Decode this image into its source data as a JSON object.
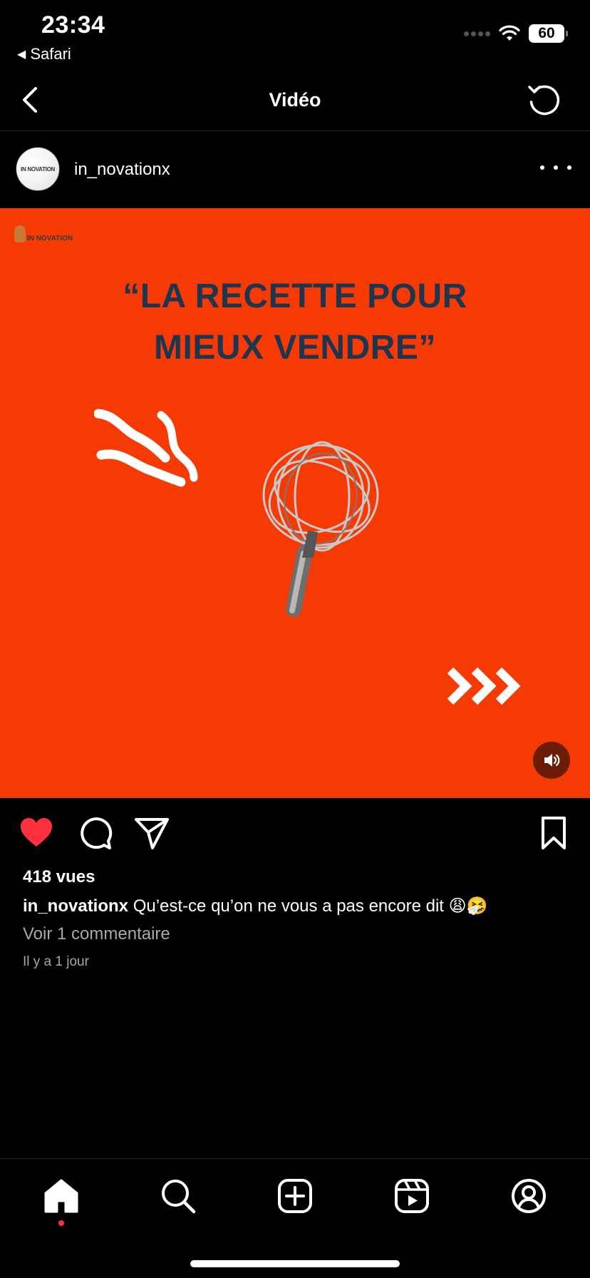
{
  "status_bar": {
    "time": "23:34",
    "back_app": "Safari",
    "battery": "60"
  },
  "header": {
    "title": "Vidéo"
  },
  "post": {
    "username": "in_novationx",
    "avatar_text": "IN NOVATION",
    "video": {
      "logo_text": "IN NOVATION",
      "headline_line1": "“LA RECETTE POUR",
      "headline_line2": "MIEUX VENDRE”",
      "background_color": "#f53a04",
      "headline_color": "#1e3550"
    },
    "views": "418 vues",
    "caption_user": "in_novationx",
    "caption_text": "Qu’est-ce qu’on ne vous a pas encore dit 😩🤧",
    "view_comments": "Voir 1 commentaire",
    "time_ago": "Il y a 1 jour",
    "liked": true
  },
  "colors": {
    "like": "#ff3040",
    "muted_text": "#a8a8a8"
  },
  "icons": {
    "back": "chevron-left-icon",
    "refresh": "refresh-icon",
    "more": "more-icon",
    "sound": "speaker-icon",
    "like": "heart-icon",
    "comment": "comment-icon",
    "share": "send-icon",
    "save": "bookmark-icon",
    "tabs": [
      "home-icon",
      "search-icon",
      "create-icon",
      "reels-icon",
      "profile-icon"
    ]
  }
}
